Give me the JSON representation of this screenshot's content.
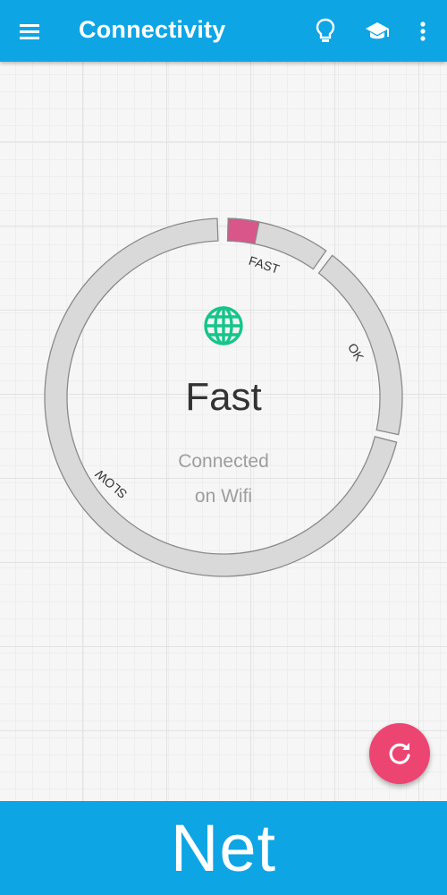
{
  "appbar": {
    "title": "Connectivity",
    "icons": [
      "menu-icon",
      "lightbulb-icon",
      "school-icon",
      "more-vert-icon"
    ]
  },
  "gauge": {
    "labels": {
      "fast": "FAST",
      "ok": "OK",
      "slow": "SLOW"
    },
    "indicator_zone": "fast",
    "indicator_color": "#d9568a",
    "track_color": "#d9d9d9"
  },
  "status": {
    "speed": "Fast",
    "line1": "Connected",
    "line2": "on Wifi",
    "icon": "globe-icon",
    "icon_color": "#16c58a"
  },
  "fab": {
    "icon": "refresh-icon",
    "color": "#ec4571"
  },
  "banner": {
    "text": "Net"
  },
  "colors": {
    "accent": "#0ea5e4"
  }
}
